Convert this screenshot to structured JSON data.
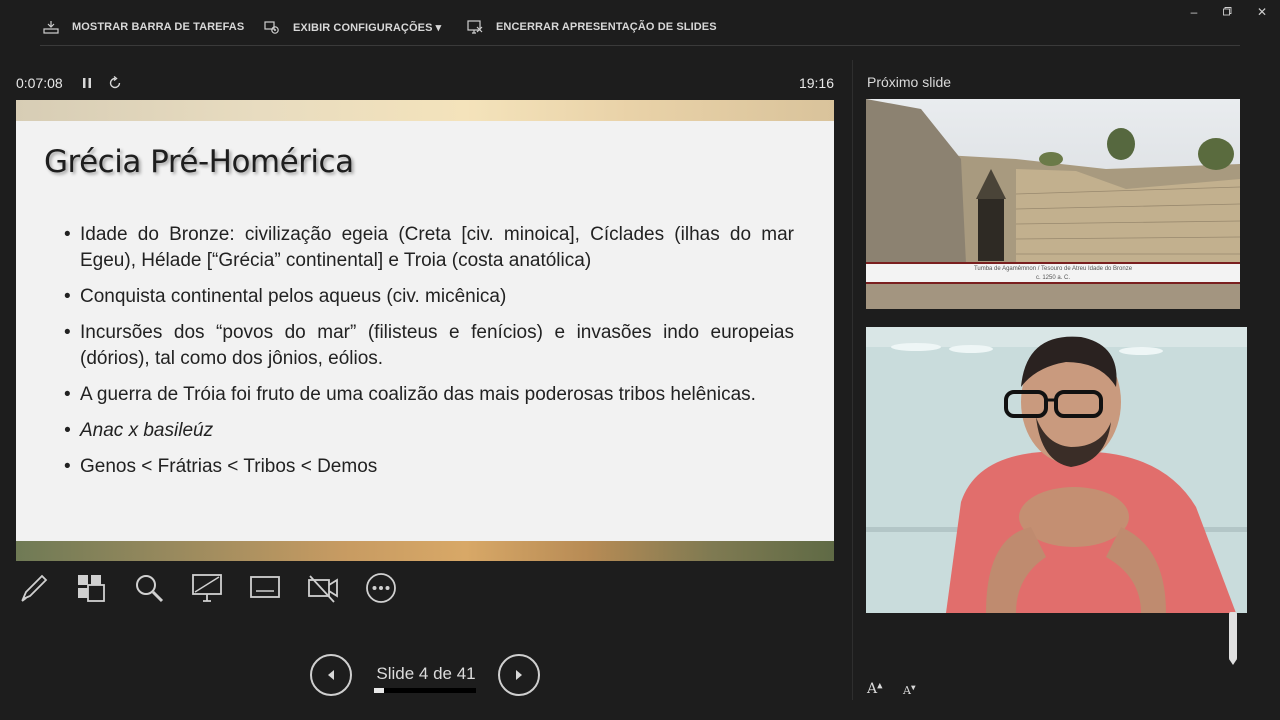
{
  "toolbar": {
    "show_taskbar": "MOSTRAR BARRA DE TAREFAS",
    "display_settings": "EXIBIR CONFIGURAÇÕES ▾",
    "end_show": "ENCERRAR APRESENTAÇÃO DE SLIDES"
  },
  "timer": {
    "elapsed": "0:07:08",
    "clock": "19:16"
  },
  "slide": {
    "title": "Grécia Pré-Homérica",
    "bullets": [
      "Idade do Bronze: civilização egeia (Creta [civ. minoica], Cíclades (ilhas do mar Egeu), Hélade [“Grécia” continental] e Troia (costa anatólica)",
      "Conquista continental pelos aqueus (civ. micênica)",
      "Incursões dos “povos do mar” (filisteus e fenícios) e invasões indo europeias (dórios), tal como dos jônios, eólios.",
      "A guerra de Tróia foi fruto de uma coalizão das mais poderosas tribos helênicas.",
      "Anac x basileúz",
      "Genos < Frátrias < Tribos < Demos"
    ]
  },
  "navigation": {
    "counter": "Slide 4 de 41",
    "progress_fraction": 0.0976
  },
  "next": {
    "label": "Próximo slide",
    "caption_line1": "Tumba de Agamêmnon / Tesouro de Atreu Idade do Bronze",
    "caption_line2": "c. 1250 a. C."
  },
  "font_controls": {
    "increase": "A",
    "decrease": "A"
  },
  "icons": {
    "pen": "pen-icon",
    "grid": "all-slides-icon",
    "zoom": "zoom-icon",
    "screen": "black-screen-icon",
    "subtitles": "subtitles-icon",
    "camera": "camera-off-icon",
    "more": "more-options-icon"
  }
}
